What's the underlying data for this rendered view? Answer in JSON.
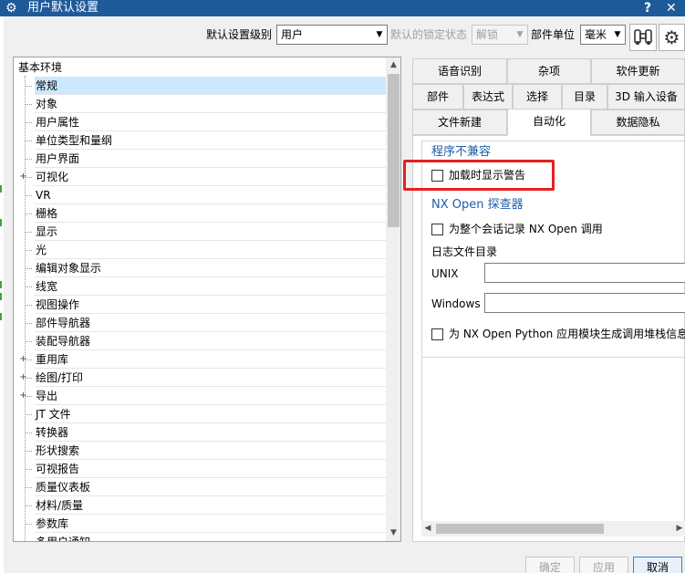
{
  "window": {
    "title": "用户默认设置",
    "help": "?",
    "close": "✕"
  },
  "toolbar": {
    "level_label": "默认设置级别",
    "level_value": "用户",
    "lock_label": "默认的锁定状态",
    "lock_value": "解锁",
    "unit_label": "部件单位",
    "unit_value": "毫米",
    "find_icon": "binoculars-icon",
    "settings_icon": "gear-icon"
  },
  "tree": {
    "root": "基本环境",
    "selected": "常规",
    "items": [
      {
        "label": "常规",
        "expandable": false
      },
      {
        "label": "对象",
        "expandable": false
      },
      {
        "label": "用户属性",
        "expandable": false
      },
      {
        "label": "单位类型和量纲",
        "expandable": false
      },
      {
        "label": "用户界面",
        "expandable": false
      },
      {
        "label": "可视化",
        "expandable": true
      },
      {
        "label": "VR",
        "expandable": false
      },
      {
        "label": "栅格",
        "expandable": false
      },
      {
        "label": "显示",
        "expandable": false
      },
      {
        "label": "光",
        "expandable": false
      },
      {
        "label": "编辑对象显示",
        "expandable": false
      },
      {
        "label": "线宽",
        "expandable": false
      },
      {
        "label": "视图操作",
        "expandable": false
      },
      {
        "label": "部件导航器",
        "expandable": false
      },
      {
        "label": "装配导航器",
        "expandable": false
      },
      {
        "label": "重用库",
        "expandable": true
      },
      {
        "label": "绘图/打印",
        "expandable": true
      },
      {
        "label": "导出",
        "expandable": true
      },
      {
        "label": "JT 文件",
        "expandable": false
      },
      {
        "label": "转换器",
        "expandable": false
      },
      {
        "label": "形状搜索",
        "expandable": false
      },
      {
        "label": "可视报告",
        "expandable": false
      },
      {
        "label": "质量仪表板",
        "expandable": false
      },
      {
        "label": "材料/质量",
        "expandable": false
      },
      {
        "label": "参数库",
        "expandable": false
      },
      {
        "label": "多用户通知",
        "expandable": false
      }
    ]
  },
  "tabs": {
    "row1": [
      "语音识别",
      "杂项",
      "软件更新"
    ],
    "row2": [
      "部件",
      "表达式",
      "选择",
      "目录",
      "3D 输入设备"
    ],
    "row3": [
      "文件新建",
      "自动化",
      "数据隐私"
    ],
    "active": "自动化"
  },
  "content": {
    "section1_title": "程序不兼容",
    "warn_on_load": "加载时显示警告",
    "section2_title": "NX Open 探查器",
    "record_calls": "为整个会话记录 NX Open 调用",
    "log_dir_label": "日志文件目录",
    "unix_label": "UNIX",
    "unix_value": "",
    "windows_label": "Windows",
    "windows_value": "",
    "python_stack": "为 NX Open Python 应用模块生成调用堆栈信息"
  },
  "buttons": {
    "ok": "确定",
    "apply": "应用",
    "cancel": "取消"
  },
  "colors": {
    "titlebar": "#1e5a9a",
    "section_title": "#1e5ea8",
    "highlight": "#e52121",
    "selection": "#cce8ff"
  }
}
